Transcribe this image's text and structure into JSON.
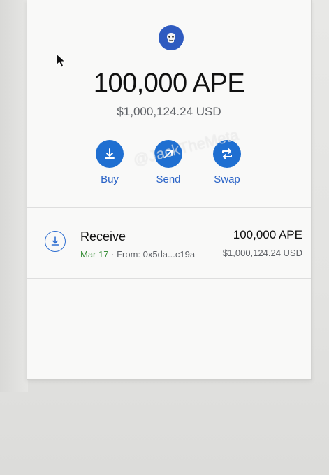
{
  "token": {
    "icon": "ape-icon",
    "balance": "100,000 APE",
    "fiat_balance": "$1,000,124.24 USD"
  },
  "actions": [
    {
      "label": "Buy",
      "icon": "download-icon"
    },
    {
      "label": "Send",
      "icon": "arrow-up-right-icon"
    },
    {
      "label": "Swap",
      "icon": "swap-icon"
    }
  ],
  "transactions": [
    {
      "type": "Receive",
      "date": "Mar 17",
      "separator": "·",
      "from": "From: 0x5da...c19a",
      "amount": "100,000 APE",
      "fiat": "$1,000,124.24 USD"
    }
  ],
  "watermark": "@JackTheMeta",
  "colors": {
    "accent": "#1f6fd1",
    "link": "#2a63c7",
    "date_green": "#3a8f3a"
  }
}
